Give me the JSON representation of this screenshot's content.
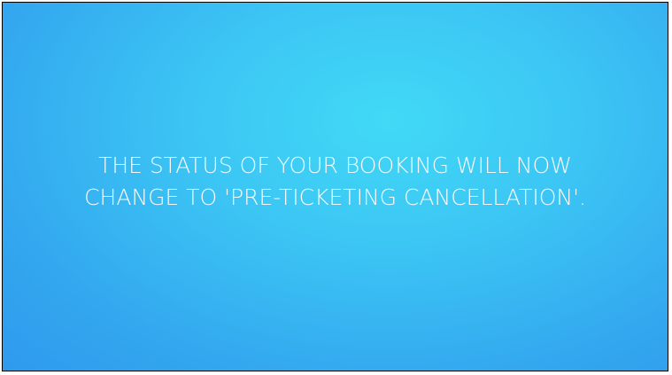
{
  "slide": {
    "message_lines": [
      "THE STATUS OF YOUR BOOKING WILL NOW",
      "CHANGE TO 'PRE-TICKETING CANCELLATION'."
    ]
  },
  "colors": {
    "background_center": "#41d9f6",
    "background_edge": "#2f9aed",
    "text": "#f4fbff",
    "border": "#000000"
  }
}
